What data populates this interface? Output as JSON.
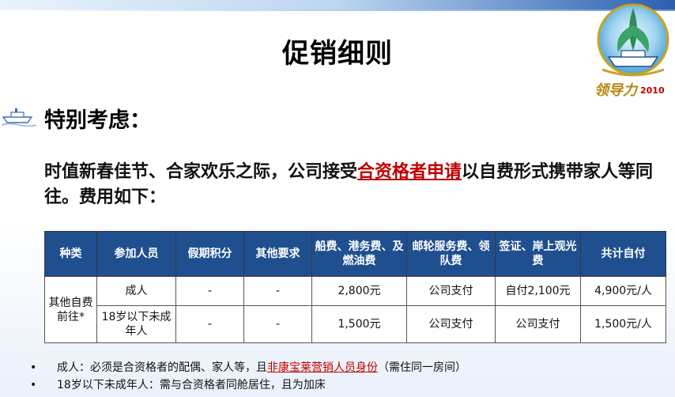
{
  "slide": {
    "title": "促销细则",
    "section_heading": "特别考虑：",
    "paragraph": {
      "before": "时值新春佳节、合家欢乐之际，公司接受",
      "highlight": "合资格者申请",
      "after": "以自费形式携带家人等同往。费用如下："
    },
    "logo_text": "领导力",
    "logo_year": "2010"
  },
  "table": {
    "headers": [
      "种类",
      "参加人员",
      "假期积分",
      "其他要求",
      "船费、港务费、及燃油费",
      "邮轮服务费、领队费",
      "签证、岸上观光费",
      "共计自付"
    ],
    "category": "其他自费前往*",
    "rows": [
      {
        "person": "成人",
        "points": "-",
        "other": "-",
        "ship_fee": "2,800元",
        "service_fee": "公司支付",
        "visa_fee": "自付2,100元",
        "total": "4,900元/人"
      },
      {
        "person": "18岁以下未成年人",
        "points": "-",
        "other": "-",
        "ship_fee": "1,500元",
        "service_fee": "公司支付",
        "visa_fee": "公司支付",
        "total": "1,500元/人"
      }
    ]
  },
  "notes": [
    {
      "bullet": "•",
      "before": "成人：必须是合资格者的配偶、家人等，且",
      "highlight": "非康宝莱营销人员身份",
      "after": "（需住同一房间）"
    },
    {
      "bullet": "•",
      "before": "18岁以下未成年人：需与合资格者同舱居住，且为加床",
      "highlight": "",
      "after": ""
    }
  ],
  "colors": {
    "header_bg": "#1f4f8e",
    "highlight": "#c00000",
    "band": "#2b5fae"
  }
}
